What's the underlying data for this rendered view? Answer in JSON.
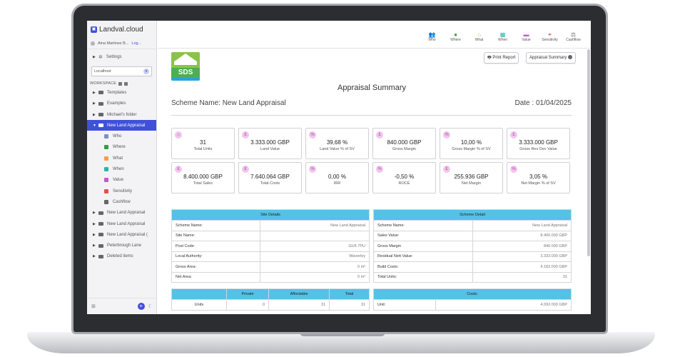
{
  "app": {
    "brand": "Landval.cloud",
    "user": "Aina Martinez B...",
    "logout": "Log...",
    "settings": "Settings",
    "environment": "Localhost",
    "workspace_label": "WORKSPACE"
  },
  "tree": {
    "folders": [
      {
        "label": "Templates"
      },
      {
        "label": "Examples"
      },
      {
        "label": "Michael's folder"
      }
    ],
    "active": "New Land Appraisal",
    "sub_items": [
      {
        "label": "Who",
        "color": "#7a8fc8"
      },
      {
        "label": "Where",
        "color": "#2ea043"
      },
      {
        "label": "What",
        "color": "#f0a04b"
      },
      {
        "label": "When",
        "color": "#2bb3a3"
      },
      {
        "label": "Value",
        "color": "#c05ac8"
      },
      {
        "label": "Sensitivity",
        "color": "#d9534f"
      },
      {
        "label": "Cashflow",
        "color": "#666666"
      }
    ],
    "more": [
      {
        "label": "New Land Appraisal"
      },
      {
        "label": "New Land Appraisal"
      },
      {
        "label": "New Land Appraisal ("
      },
      {
        "label": "Peterbrough Lane"
      },
      {
        "label": "Deleted items"
      }
    ]
  },
  "nav": [
    {
      "label": "Who",
      "icon": "users-icon",
      "glyph": "👥",
      "color": "#7a8fc8"
    },
    {
      "label": "Where",
      "icon": "pin-icon",
      "glyph": "●",
      "color": "#2ea043"
    },
    {
      "label": "What",
      "icon": "house-icon",
      "glyph": "⌂",
      "color": "#f0a04b"
    },
    {
      "label": "When",
      "icon": "calendar-icon",
      "glyph": "▦",
      "color": "#2bb3a3"
    },
    {
      "label": "Value",
      "icon": "value-icon",
      "glyph": "▬",
      "color": "#c05ac8"
    },
    {
      "label": "Sensitivity",
      "icon": "sensitivity-icon",
      "glyph": "⚭",
      "color": "#d9534f"
    },
    {
      "label": "Cashflow",
      "icon": "cashflow-icon",
      "glyph": "⚖",
      "color": "#666666"
    }
  ],
  "buttons": {
    "print": "Print Report",
    "summary": "Appraisal Summary"
  },
  "report": {
    "title": "Appraisal Summary",
    "scheme": "Scheme Name: New Land Appraisal",
    "date": "Date : 01/04/2025",
    "logo_text": "SDS"
  },
  "kpis": [
    {
      "value": "31",
      "label": "Total Units",
      "icon": "⌂"
    },
    {
      "value": "3.333.000 GBP",
      "label": "Land Value",
      "icon": "£"
    },
    {
      "value": "39,68 %",
      "label": "Land Value % of SV",
      "icon": "%"
    },
    {
      "value": "840.000 GBP",
      "label": "Gross Margin",
      "icon": "£"
    },
    {
      "value": "10,00 %",
      "label": "Gross Margin % of SV",
      "icon": "%"
    },
    {
      "value": "3.333.000 GBP",
      "label": "Gross Res Dev Value",
      "icon": "£"
    },
    {
      "value": "8.400.000 GBP",
      "label": "Total Sales",
      "icon": "£"
    },
    {
      "value": "7.640.064 GBP",
      "label": "Total Costs",
      "icon": "£"
    },
    {
      "value": "0,00 %",
      "label": "IRR",
      "icon": "%"
    },
    {
      "value": "-0,50 %",
      "label": "ROCE",
      "icon": "%"
    },
    {
      "value": "255.936 GBP",
      "label": "Net Margin",
      "icon": "£"
    },
    {
      "value": "3,05 %",
      "label": "Net Margin % of SV",
      "icon": "%"
    }
  ],
  "site_details": {
    "header": "Site Details",
    "rows": [
      [
        "Scheme Name:",
        "New Land Appraisal"
      ],
      [
        "Site Name:",
        ""
      ],
      [
        "Post Code:",
        "GU6 7PU"
      ],
      [
        "Local Authority:",
        "Waverley"
      ],
      [
        "Gross Area:",
        "0 m²"
      ],
      [
        "Net Area:",
        "0 m²"
      ]
    ]
  },
  "scheme_detail": {
    "header": "Scheme Detail",
    "rows": [
      [
        "Scheme Name:",
        "New Land Appraisal"
      ],
      [
        "Sales Value:",
        "8.400.000 GBP"
      ],
      [
        "Gross Margin",
        "840.000 GBP"
      ],
      [
        "Residual Nett Value:",
        "3.333.000 GBP"
      ],
      [
        "Build Costs:",
        "4.182.000 GBP"
      ],
      [
        "Total Units:",
        "31"
      ]
    ]
  },
  "units_table": {
    "headers": [
      "",
      "Private",
      "Affordable",
      "Total"
    ],
    "rows": [
      [
        "Units",
        "0",
        "31",
        "31"
      ]
    ]
  },
  "costs_table": {
    "header": "Costs:",
    "rows": [
      [
        "Unit:",
        "4.092.000 GBP"
      ]
    ]
  }
}
